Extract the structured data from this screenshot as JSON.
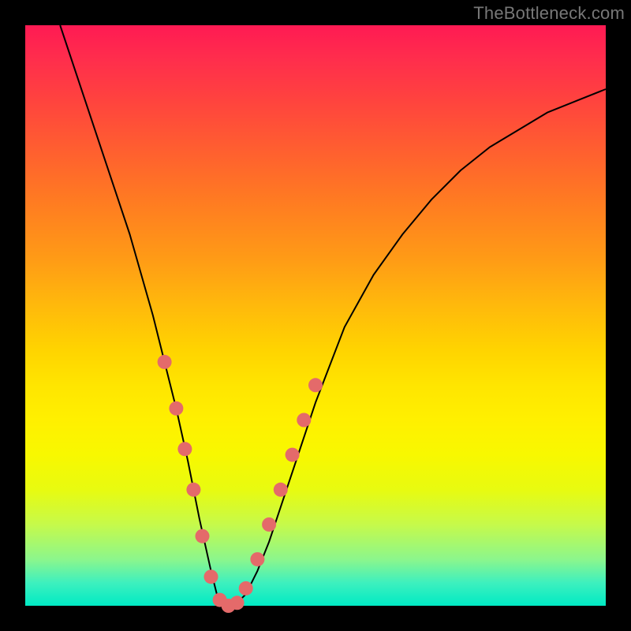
{
  "watermark": "TheBottleneck.com",
  "chart_data": {
    "type": "line",
    "title": "",
    "xlabel": "",
    "ylabel": "",
    "xlim": [
      0,
      100
    ],
    "ylim": [
      0,
      100
    ],
    "grid": false,
    "legend": false,
    "series": [
      {
        "name": "curve",
        "color": "#000000",
        "width": 2,
        "x": [
          6,
          10,
          14,
          18,
          22,
          24,
          26,
          28,
          30,
          32,
          33,
          34,
          35,
          36,
          38,
          40,
          42,
          44,
          46,
          50,
          55,
          60,
          65,
          70,
          75,
          80,
          85,
          90,
          95,
          100
        ],
        "values": [
          100,
          88,
          76,
          64,
          50,
          42,
          34,
          25,
          15,
          6,
          2,
          0,
          0,
          0,
          2,
          6,
          11,
          17,
          23,
          35,
          48,
          57,
          64,
          70,
          75,
          79,
          82,
          85,
          87,
          89
        ]
      }
    ],
    "markers": {
      "name": "highlight-beads",
      "color": "#e46a6a",
      "radius": 9,
      "points": [
        {
          "x": 24,
          "y": 42
        },
        {
          "x": 26,
          "y": 34
        },
        {
          "x": 27.5,
          "y": 27
        },
        {
          "x": 29,
          "y": 20
        },
        {
          "x": 30.5,
          "y": 12
        },
        {
          "x": 32,
          "y": 5
        },
        {
          "x": 33.5,
          "y": 1
        },
        {
          "x": 35,
          "y": 0
        },
        {
          "x": 36.5,
          "y": 0.5
        },
        {
          "x": 38,
          "y": 3
        },
        {
          "x": 40,
          "y": 8
        },
        {
          "x": 42,
          "y": 14
        },
        {
          "x": 44,
          "y": 20
        },
        {
          "x": 46,
          "y": 26
        },
        {
          "x": 48,
          "y": 32
        },
        {
          "x": 50,
          "y": 38
        }
      ]
    }
  },
  "colors": {
    "frame": "#000000",
    "watermark": "#777777"
  }
}
